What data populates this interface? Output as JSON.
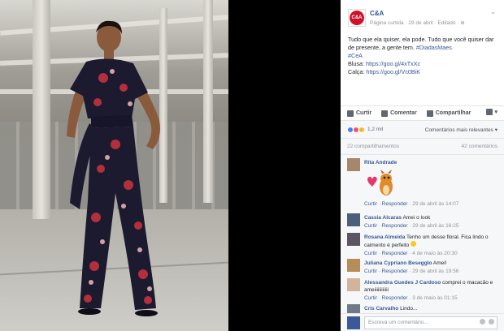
{
  "post": {
    "page_name": "C&A",
    "avatar_text": "C&A",
    "meta": "Página curtida · 29 de abril · Editado ·",
    "text_line1": "Tudo que ela quiser, ela pode. Tudo que você quiser dar de presente, a gente tem.",
    "hashtag1": "#DiadasMaes",
    "hashtag2": "#CeA",
    "blusa_label": "Blusa:",
    "blusa_link": "https://goo.gl/4xTxXc",
    "calca_label": "Calça:",
    "calca_link": "https://goo.gl/Vc0BiK"
  },
  "actions": {
    "like": "Curtir",
    "comment": "Comentar",
    "share": "Compartilhar"
  },
  "reactions": {
    "count": "1,2 mil",
    "sort": "Comentários mais relevantes ▾"
  },
  "counts": {
    "shares": "22 compartilhamentos",
    "comments": "42 comentários"
  },
  "comments": [
    {
      "name": "Rita Andrade",
      "text": "",
      "foot_like": "Curtir",
      "foot_reply": "Responder",
      "foot_time": "29 de abril às 14:07"
    },
    {
      "name": "Cassia Alcaras",
      "text": "Amei o look",
      "foot_like": "Curtir",
      "foot_reply": "Responder",
      "foot_time": "29 de abril às 16:25"
    },
    {
      "name": "Rosana Almeida",
      "text": "Tenho um desse floral. Fica lindo o caimento é perfeito",
      "foot_like": "Curtir",
      "foot_reply": "Responder",
      "foot_time": "4 de maio às 20:30"
    },
    {
      "name": "Juliana Cypriano Besegglo",
      "text": "Amei!",
      "foot_like": "Curtir",
      "foot_reply": "Responder",
      "foot_time": "29 de abril às 19:56"
    },
    {
      "name": "Alessandra Guedes J Cardoso",
      "text": "comprei o macacão e ameiiiiiiiiiiii",
      "foot_like": "Curtir",
      "foot_reply": "Responder",
      "foot_time": "3 de maio às 01:15"
    },
    {
      "name": "Cris Carvalho",
      "text": "Lindo...",
      "foot_like": "",
      "foot_reply": "",
      "foot_time": ""
    }
  ],
  "write": {
    "placeholder": "Escreva um comentário..."
  },
  "colors": {
    "link": "#365899",
    "brand": "#d0102b"
  }
}
